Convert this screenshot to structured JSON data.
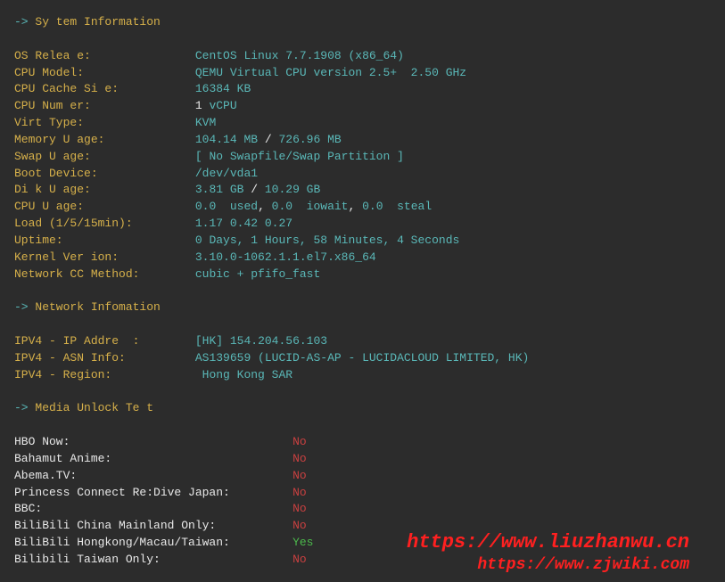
{
  "sections": {
    "sys_header": "-> Sy tem Information",
    "net_header": "-> Network Infomation",
    "media_header": "-> Media Unlock Te t"
  },
  "sys": {
    "os_release_label": "OS Relea e:",
    "os_release_value": "CentOS Linux 7.7.1908 (x86_64)",
    "cpu_model_label": "CPU Model:",
    "cpu_model_value": "QEMU Virtual CPU version 2.5+  2.50 GHz",
    "cpu_cache_label": "CPU Cache Si e:",
    "cpu_cache_value": "16384 KB",
    "cpu_num_label": "CPU Num er:",
    "cpu_num_count": "1",
    "cpu_num_unit": " vCPU",
    "virt_type_label": "Virt Type:",
    "virt_type_value": "KVM",
    "mem_label": "Memory U age:",
    "mem_used": "104.14 MB",
    "mem_sep": " / ",
    "mem_total": "726.96 MB",
    "swap_label": "Swap U age:",
    "swap_value": "[ No Swapfile/Swap Partition ]",
    "boot_label": "Boot Device:",
    "boot_value": "/dev/vda1",
    "disk_label": "Di k U age:",
    "disk_used": "3.81 GB",
    "disk_sep": " / ",
    "disk_total": "10.29 GB",
    "cpuu_label": "CPU U age:",
    "cpuu_v1": "0.0",
    "cpuu_t1": "  used",
    "cpuu_c1": ", ",
    "cpuu_v2": "0.0",
    "cpuu_t2": "  iowait",
    "cpuu_c2": ", ",
    "cpuu_v3": "0.0",
    "cpuu_t3": "  steal",
    "load_label": "Load (1/5/15min):",
    "load_value": "1.17 0.42 0.27",
    "uptime_label": "Uptime:",
    "uptime_value": "0 Days, 1 Hours, 58 Minutes, 4 Seconds",
    "kernel_label": "Kernel Ver ion:",
    "kernel_value": "3.10.0-1062.1.1.el7.x86_64",
    "netcc_label": "Network CC Method:",
    "netcc_value": "cubic + pfifo_fast"
  },
  "net": {
    "ip_label": "IPV4 - IP Addre  :",
    "ip_region": "[HK]",
    "ip_addr": " 154.204.56.103",
    "asn_label": "IPV4 - ASN Info:",
    "asn_value": "AS139659 (LUCID-AS-AP - LUCIDACLOUD LIMITED, HK)",
    "region_label": "IPV4 - Region:",
    "region_value": " Hong Kong SAR"
  },
  "media": {
    "hbo_label": "HBO Now:",
    "hbo_value": "No",
    "bahamut_label": "Bahamut Anime:",
    "bahamut_value": "No",
    "abema_label": "Abema.TV:",
    "abema_value": "No",
    "priconne_label": "Princess Connect Re:Dive Japan:",
    "priconne_value": "No",
    "bbc_label": "BBC:",
    "bbc_value": "No",
    "bili_cn_label": "BiliBili China Mainland Only:",
    "bili_cn_value": "No",
    "bili_hk_label": "BiliBili Hongkong/Macau/Taiwan:",
    "bili_hk_value": "Yes",
    "bili_tw_label": "Bilibili Taiwan Only:",
    "bili_tw_value": "No"
  },
  "watermark": {
    "line1": "https://www.liuzhanwu.cn",
    "line2": "https://www.zjwiki.com"
  }
}
